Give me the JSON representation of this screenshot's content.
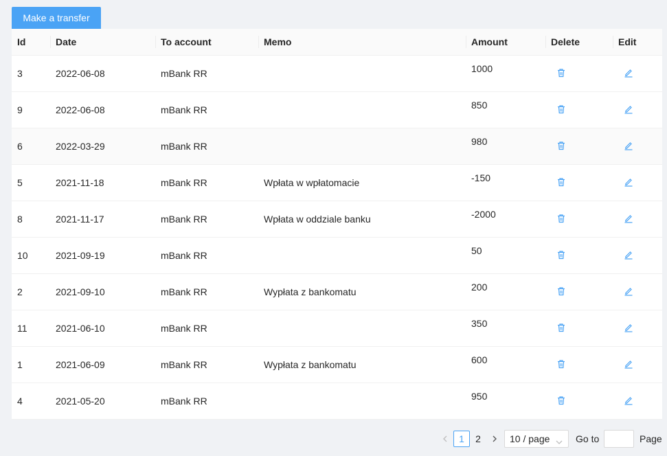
{
  "toolbar": {
    "make_transfer_label": "Make a transfer"
  },
  "table": {
    "columns": [
      "Id",
      "Date",
      "To account",
      "Memo",
      "Amount",
      "Delete",
      "Edit"
    ],
    "rows": [
      {
        "id": "3",
        "date": "2022-06-08",
        "to_account": "mBank RR",
        "memo": "",
        "amount": "1000"
      },
      {
        "id": "9",
        "date": "2022-06-08",
        "to_account": "mBank RR",
        "memo": "",
        "amount": "850"
      },
      {
        "id": "6",
        "date": "2022-03-29",
        "to_account": "mBank RR",
        "memo": "",
        "amount": "980"
      },
      {
        "id": "5",
        "date": "2021-11-18",
        "to_account": "mBank RR",
        "memo": "Wpłata w wpłatomacie",
        "amount": "-150"
      },
      {
        "id": "8",
        "date": "2021-11-17",
        "to_account": "mBank RR",
        "memo": "Wpłata w oddziale banku",
        "amount": "-2000"
      },
      {
        "id": "10",
        "date": "2021-09-19",
        "to_account": "mBank RR",
        "memo": "",
        "amount": "50"
      },
      {
        "id": "2",
        "date": "2021-09-10",
        "to_account": "mBank RR",
        "memo": "Wypłata z bankomatu",
        "amount": "200"
      },
      {
        "id": "11",
        "date": "2021-06-10",
        "to_account": "mBank RR",
        "memo": "",
        "amount": "350"
      },
      {
        "id": "1",
        "date": "2021-06-09",
        "to_account": "mBank RR",
        "memo": "Wypłata z bankomatu",
        "amount": "600"
      },
      {
        "id": "4",
        "date": "2021-05-20",
        "to_account": "mBank RR",
        "memo": "",
        "amount": "950"
      }
    ],
    "highlighted_row": 2
  },
  "pagination": {
    "prev_icon": "chevron-left-icon",
    "next_icon": "chevron-right-icon",
    "current_page": "1",
    "other_page": "2",
    "page_size": "10 / page",
    "goto_label": "Go to",
    "goto_value": "",
    "page_label": "Page"
  },
  "colors": {
    "accent": "#4aa3f5",
    "background": "#f0f2f5",
    "header_bg": "#fafafa",
    "border": "#f0f0f0"
  }
}
